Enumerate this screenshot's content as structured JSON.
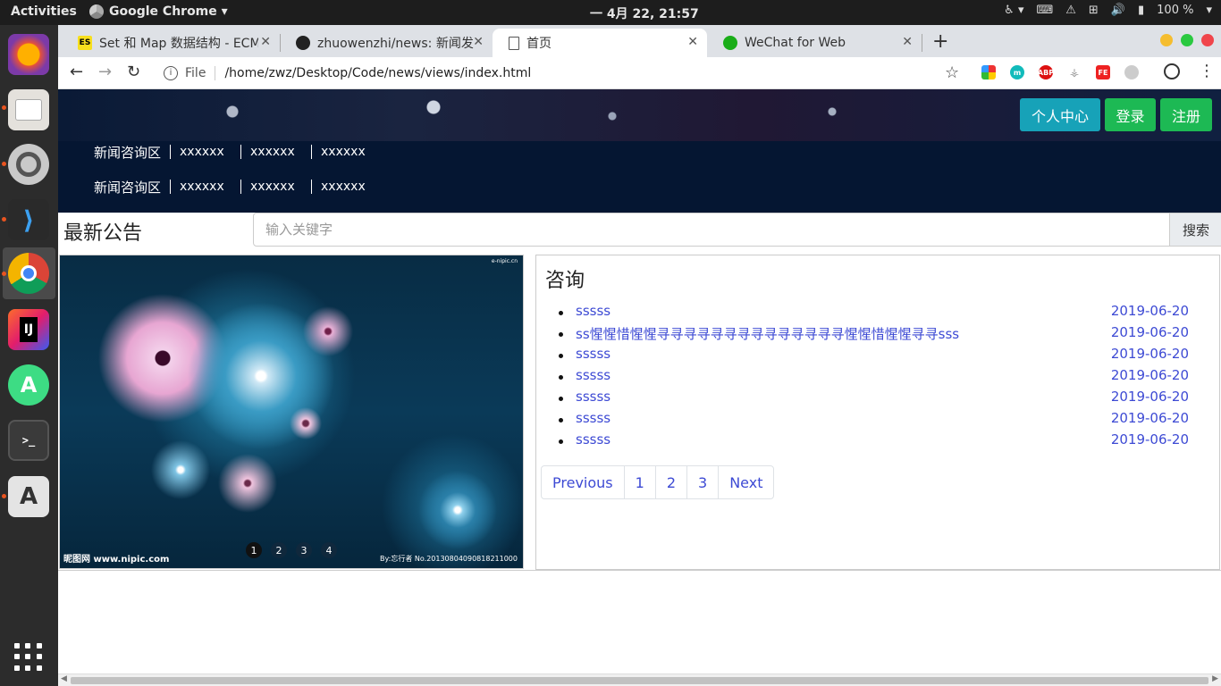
{
  "system": {
    "activities": "Activities",
    "app_name": "Google Chrome ▾",
    "clock": "一 4月 22, 21:57",
    "battery": "100 %"
  },
  "browser": {
    "tabs": [
      {
        "title": "Set 和 Map 数据结构 - ECM",
        "favicon": "es-icon"
      },
      {
        "title": "zhuowenzhi/news: 新闻发",
        "favicon": "github-icon"
      },
      {
        "title": "首页",
        "favicon": "page-icon"
      },
      {
        "title": "WeChat for Web",
        "favicon": "wechat-icon"
      }
    ],
    "address_scheme": "File",
    "address_url": "/home/zwz/Desktop/Code/news/views/index.html"
  },
  "page": {
    "user_center": "个人中心",
    "login": "登录",
    "register": "注册",
    "nav_rows": [
      {
        "title": "新闻咨询区",
        "links": [
          "xxxxxx",
          "xxxxxx",
          "xxxxxx"
        ]
      },
      {
        "title": "新闻咨询区",
        "links": [
          "xxxxxx",
          "xxxxxx",
          "xxxxxx"
        ]
      }
    ],
    "latest_title": "最新公告",
    "search_placeholder": "输入关键字",
    "search_button": "搜索",
    "carousel": {
      "watermark_left": "昵图网 www.nipic.com",
      "watermark_right": "By:忘行者 No.20130804090818211000",
      "watermark_top": "e-nipic.cn",
      "indicators": [
        "1",
        "2",
        "3",
        "4"
      ],
      "active_index": 1
    },
    "news_title": "咨询",
    "news": [
      {
        "title": "sssss",
        "date": "2019-06-20"
      },
      {
        "title": "ss惺惺惜惺惺寻寻寻寻寻寻寻寻寻寻寻寻寻寻惺惺惜惺惺寻寻sss",
        "date": "2019-06-20"
      },
      {
        "title": "sssss",
        "date": "2019-06-20"
      },
      {
        "title": "sssss",
        "date": "2019-06-20"
      },
      {
        "title": "sssss",
        "date": "2019-06-20"
      },
      {
        "title": "sssss",
        "date": "2019-06-20"
      },
      {
        "title": "sssss",
        "date": "2019-06-20"
      }
    ],
    "pagination": [
      "Previous",
      "1",
      "2",
      "3",
      "Next"
    ]
  },
  "colors": {
    "user_center_bg": "#17a2b8",
    "login_bg": "#1db954",
    "register_bg": "#1db954",
    "link": "#3d4ad4",
    "navbar_bg": "#051632"
  }
}
